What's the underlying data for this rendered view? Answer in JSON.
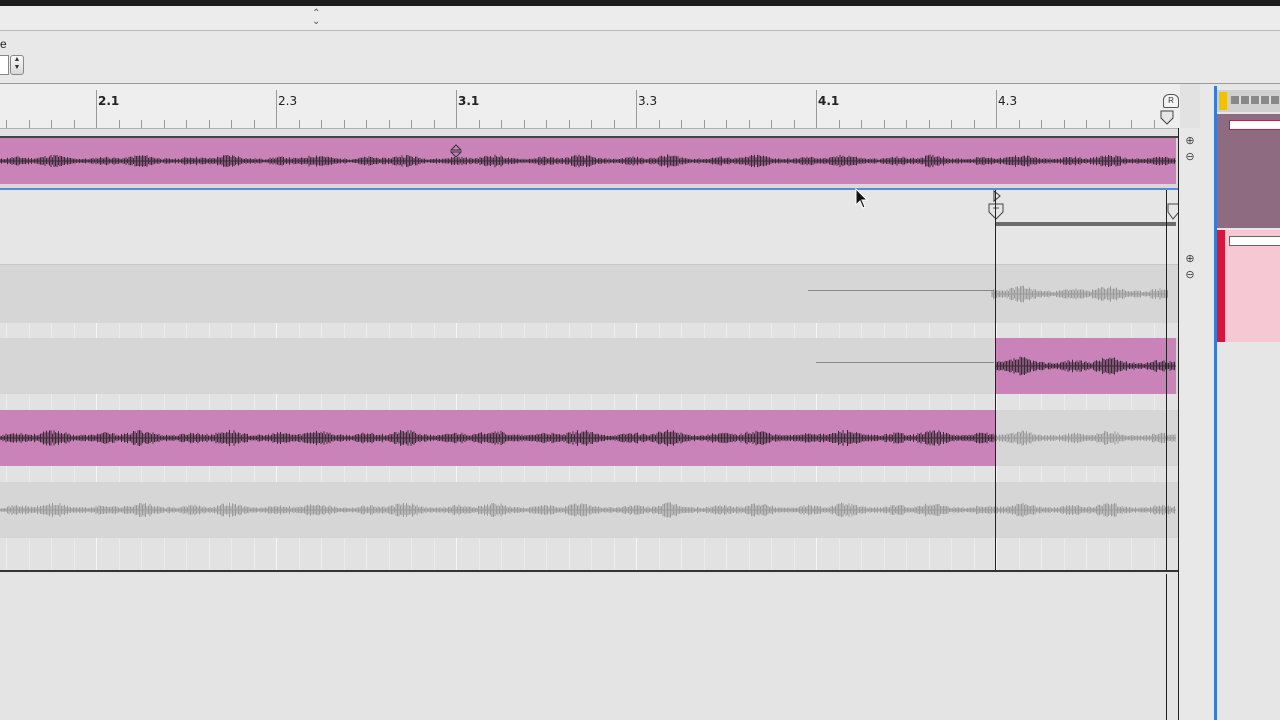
{
  "control_bar": {
    "label": "e"
  },
  "ruler": {
    "bars": [
      {
        "label": "2.1",
        "main": true
      },
      {
        "label": "2.3",
        "main": false
      },
      {
        "label": "3.1",
        "main": true
      },
      {
        "label": "3.3",
        "main": false
      },
      {
        "label": "4.1",
        "main": true
      },
      {
        "label": "4.3",
        "main": false
      }
    ],
    "end_marker": "R"
  },
  "colors": {
    "clip_pink": "#c983b9",
    "side_red": "#d8153a",
    "side_pink": "#f5c8d3",
    "side_mauve": "#8e6b80",
    "selection_blue": "#3b7bd6",
    "waveform_dark": "#3a2a35",
    "waveform_grey": "#9a9a9a"
  },
  "icons": {
    "zoom_in": "zoom-in-icon",
    "zoom_out": "zoom-out-icon",
    "loop_start": "loop-start-icon",
    "loop_end": "loop-end-icon",
    "cursor": "cursor-icon"
  }
}
